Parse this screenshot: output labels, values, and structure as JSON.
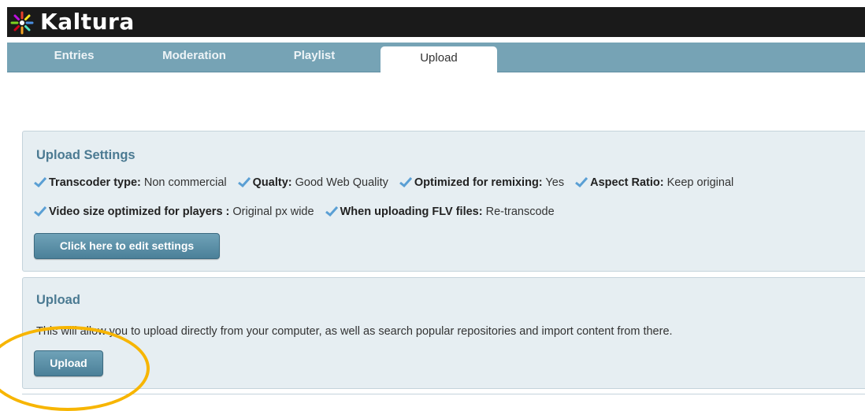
{
  "app": {
    "name": "Kaltura"
  },
  "tabs": [
    "Entries",
    "Moderation",
    "Playlist",
    "Upload"
  ],
  "active_tab": "Upload",
  "upload_settings": {
    "title": "Upload Settings",
    "row1": [
      {
        "label": "Transcoder type:",
        "value": "Non commercial"
      },
      {
        "label": "Qualty:",
        "value": "Good Web Quality"
      },
      {
        "label": "Optimized for remixing:",
        "value": "Yes"
      },
      {
        "label": "Aspect Ratio:",
        "value": "Keep original"
      }
    ],
    "row2": [
      {
        "label": "Video size optimized for players :",
        "value": "Original px wide"
      },
      {
        "label": "When uploading FLV files:",
        "value": "Re-transcode"
      }
    ],
    "edit_button": "Click here to edit settings"
  },
  "upload": {
    "title": "Upload",
    "description": "This will allow you to upload directly from your computer, as well as search popular repositories and import content from there.",
    "button": "Upload"
  },
  "colors": {
    "accent": "#4b7a92",
    "highlight": "#f7b500",
    "check": "#5a9fd4"
  }
}
